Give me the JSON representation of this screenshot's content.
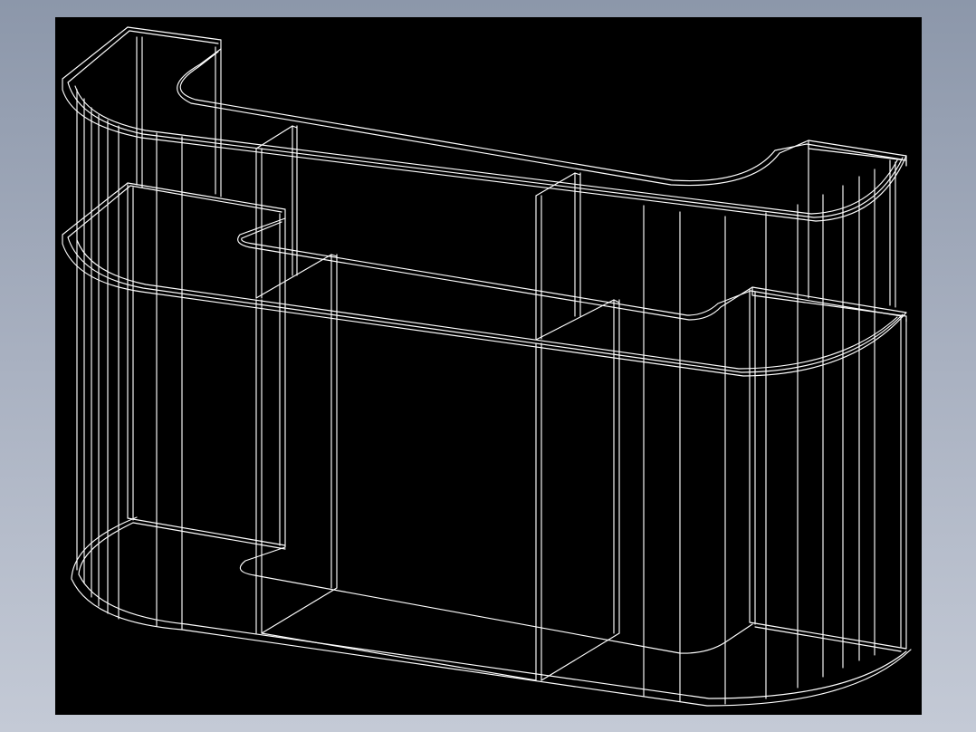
{
  "scene": {
    "kind": "cad-wireframe",
    "subject": "reception-counter",
    "background_color": "#000000",
    "line_color": "#ffffff",
    "frame_gradient": [
      "#8c97aa",
      "#c4cad6"
    ]
  }
}
